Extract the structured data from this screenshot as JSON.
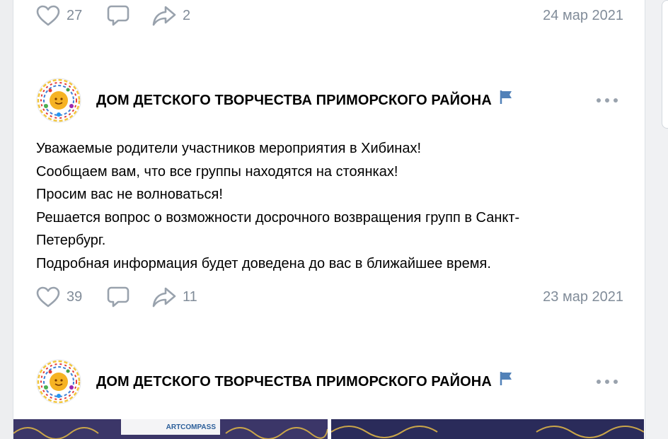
{
  "posts": [
    {
      "likes": "27",
      "shares": "2",
      "date": "24 мар 2021"
    },
    {
      "author": "ДОМ ДЕТСКОГО ТВОРЧЕСТВА ПРИМОРСКОГО РАЙОНА",
      "text_lines": [
        "Уважаемые родители участников мероприятия в Хибинах!",
        "Сообщаем вам, что все группы находятся на стоянках!",
        "Просим вас не волноваться!",
        "Решается вопрос о возможности досрочного возвращения групп в Санкт-",
        "Петербург.",
        "Подробная информация будет доведена до вас в ближайшее время."
      ],
      "likes": "39",
      "shares": "11",
      "date": "23 мар 2021"
    },
    {
      "author": "ДОМ ДЕТСКОГО ТВОРЧЕСТВА ПРИМОРСКОГО РАЙОНА",
      "media_label": "ARTCOMPASS"
    }
  ],
  "icons": {
    "like": "heart-icon",
    "comment": "comment-icon",
    "share": "share-icon",
    "verified": "flag-icon",
    "more": "more-dots-icon"
  },
  "colors": {
    "meta_text": "#818c99",
    "icon": "#99a2ad",
    "flag": "#5181b8",
    "background": "#edeef0"
  }
}
